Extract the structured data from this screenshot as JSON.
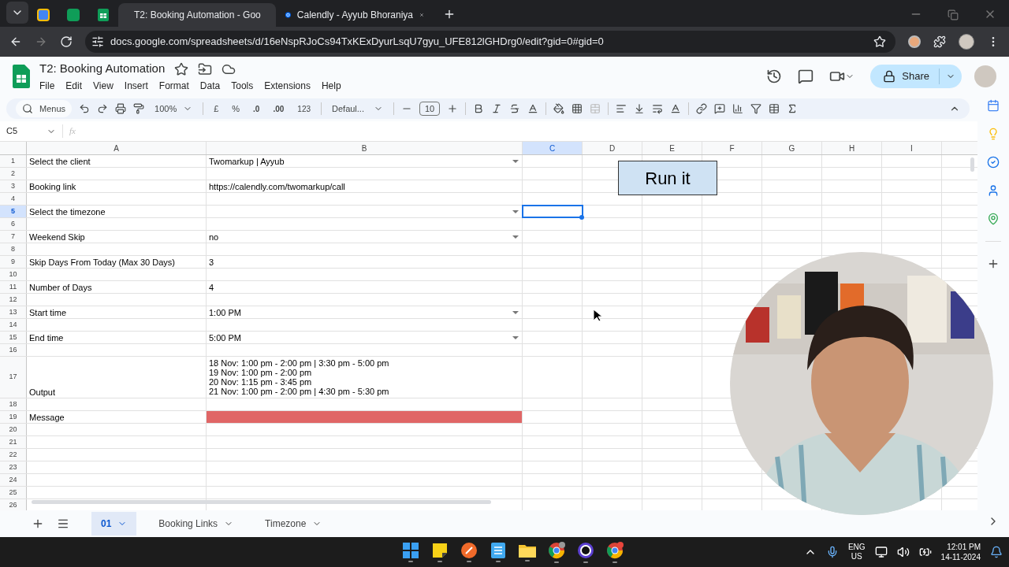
{
  "browser": {
    "tabs": [
      {
        "kind": "calendar",
        "selected": false
      },
      {
        "kind": "app",
        "selected": false
      },
      {
        "kind": "sheets",
        "selected": false
      },
      {
        "kind": "sheets",
        "title": "T2: Booking Automation - Goo",
        "selected": true
      },
      {
        "kind": "calendly",
        "title": "Calendly - Ayyub Bhoraniya",
        "selected": false
      }
    ],
    "address": "docs.google.com/spreadsheets/d/16eNspRJoCs94TxKExDyurLsqU7gyu_UFE812lGHDrg0/edit?gid=0#gid=0"
  },
  "doc": {
    "title": "T2: Booking Automation",
    "menu": [
      "File",
      "Edit",
      "View",
      "Insert",
      "Format",
      "Data",
      "Tools",
      "Extensions",
      "Help"
    ],
    "share": "Share"
  },
  "toolbar": {
    "search": "Menus",
    "zoom": "100%",
    "currency": "£",
    "percent": "%",
    "decrease_decimals": ".0",
    "increase_decimals": ".00",
    "number_format": "123",
    "font": "Defaul...",
    "font_size": "10"
  },
  "formula_bar": {
    "cell_ref": "C5",
    "function_label": "fx"
  },
  "grid": {
    "columns": [
      {
        "label": "A",
        "selected": false
      },
      {
        "label": "B",
        "selected": false
      },
      {
        "label": "C",
        "selected": true
      },
      {
        "label": "D",
        "selected": false
      },
      {
        "label": "E",
        "selected": false
      },
      {
        "label": "F",
        "selected": false
      },
      {
        "label": "G",
        "selected": false
      },
      {
        "label": "H",
        "selected": false
      },
      {
        "label": "I",
        "selected": false
      }
    ],
    "rows": [
      {
        "number": "1",
        "label": "Select the client",
        "value": "Twomarkup | Ayyub",
        "dropdown": true,
        "selected": false
      },
      {
        "number": "2",
        "dropdown": false,
        "selected": false
      },
      {
        "number": "3",
        "label": "Booking link",
        "value": "https://calendly.com/twomarkup/call",
        "dropdown": false,
        "selected": false
      },
      {
        "number": "4",
        "dropdown": false,
        "selected": false
      },
      {
        "number": "5",
        "label": "Select the timezone",
        "dropdown": true,
        "selected": true
      },
      {
        "number": "6",
        "dropdown": false,
        "selected": false
      },
      {
        "number": "7",
        "label": "Weekend Skip",
        "value": "no",
        "dropdown": true,
        "selected": false
      },
      {
        "number": "8",
        "dropdown": false,
        "selected": false
      },
      {
        "number": "9",
        "label": "Skip Days From Today (Max 30 Days)",
        "value": "3",
        "dropdown": false,
        "selected": false
      },
      {
        "number": "10",
        "dropdown": false,
        "selected": false
      },
      {
        "number": "11",
        "label": "Number of Days",
        "value": "4",
        "dropdown": false,
        "selected": false
      },
      {
        "number": "12",
        "dropdown": false,
        "selected": false
      },
      {
        "number": "13",
        "label": "Start time",
        "value": "1:00 PM",
        "dropdown": true,
        "selected": false
      },
      {
        "number": "14",
        "dropdown": false,
        "selected": false
      },
      {
        "number": "15",
        "label": "End time",
        "value": "5:00 PM",
        "dropdown": true,
        "selected": false
      },
      {
        "number": "16",
        "dropdown": false,
        "selected": false
      },
      {
        "number": "17",
        "label": "Output",
        "lines": [
          "18 Nov: 1:00 pm - 2:00 pm | 3:30 pm - 5:00 pm",
          "19 Nov: 1:00 pm - 2:00 pm",
          "20 Nov: 1:15 pm - 3:45 pm",
          "21 Nov: 1:00 pm - 2:00 pm | 4:30 pm - 5:30 pm"
        ],
        "dropdown": false,
        "selected": false
      },
      {
        "number": "18",
        "dropdown": false,
        "selected": false
      },
      {
        "number": "19",
        "label": "Message",
        "dropdown": false,
        "selected": false,
        "color": "#e06666"
      },
      {
        "number": "20",
        "dropdown": false,
        "selected": false
      },
      {
        "number": "21",
        "dropdown": false,
        "selected": false
      },
      {
        "number": "22",
        "dropdown": false,
        "selected": false
      },
      {
        "number": "23",
        "dropdown": false,
        "selected": false
      },
      {
        "number": "24",
        "dropdown": false,
        "selected": false
      },
      {
        "number": "25",
        "dropdown": false,
        "selected": false
      },
      {
        "number": "26",
        "dropdown": false,
        "selected": false
      }
    ]
  },
  "run_button": "Run it",
  "sheet_tabs": [
    {
      "label": "01",
      "selected": true
    },
    {
      "label": "Booking Links",
      "selected": false
    },
    {
      "label": "Timezone",
      "selected": false
    }
  ],
  "taskbar": {
    "apps": [
      {
        "kind": "windows"
      },
      {
        "kind": "notes"
      },
      {
        "kind": "pen"
      },
      {
        "kind": "notepad"
      },
      {
        "kind": "folder"
      },
      {
        "kind": "chrome-profile"
      },
      {
        "kind": "circle-app"
      },
      {
        "kind": "chrome"
      }
    ],
    "language": "ENG",
    "region": "US",
    "time": "12:01 PM",
    "date": "14-11-2024"
  }
}
